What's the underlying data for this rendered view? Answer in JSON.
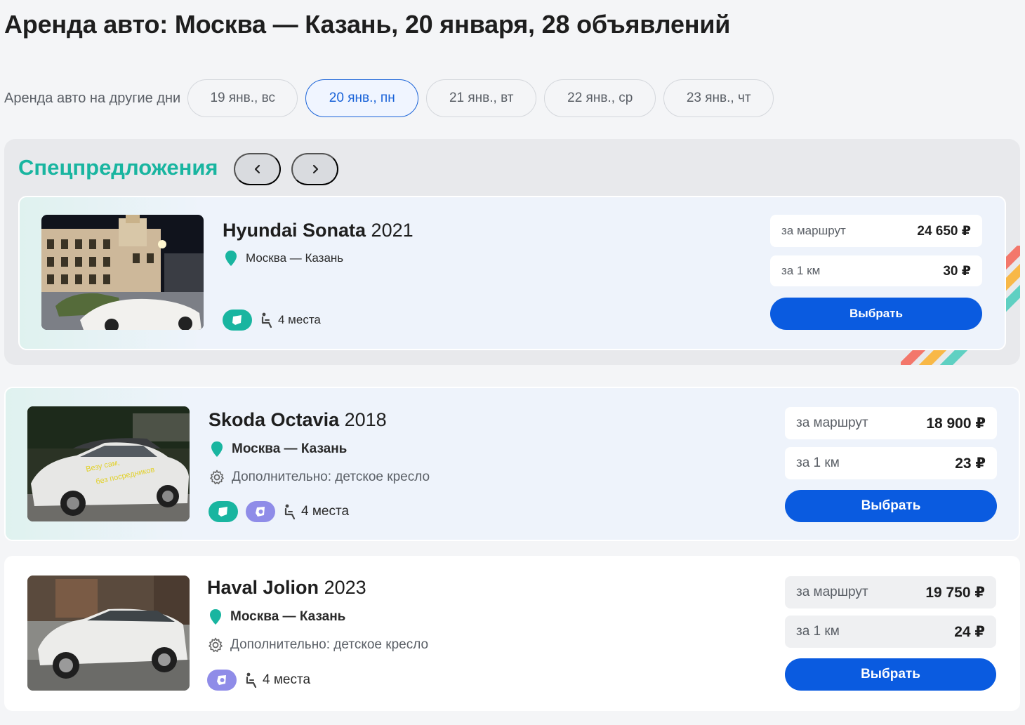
{
  "page": {
    "title": "Аренда авто: Москва — Казань, 20 января, 28 объявлений"
  },
  "days": {
    "label": "Аренда авто на другие дни",
    "items": [
      {
        "label": "19 янв., вс",
        "active": false
      },
      {
        "label": "20 янв., пн",
        "active": true
      },
      {
        "label": "21 янв., вт",
        "active": false
      },
      {
        "label": "22 янв., ср",
        "active": false
      },
      {
        "label": "23 янв., чт",
        "active": false
      }
    ]
  },
  "special": {
    "title": "Спецпредложения",
    "prev_icon": "chevron-left-icon",
    "next_icon": "chevron-right-icon"
  },
  "colors": {
    "accent_green": "#19b5a0",
    "accent_blue": "#0a5be0",
    "accent_purple": "#8f8ce8",
    "active_day": "#1a63d8"
  },
  "listings": [
    {
      "model": "Hyundai Sonata",
      "year": "2021",
      "route": "Москва — Казань",
      "extra": "",
      "features": [
        "car-chip-icon"
      ],
      "seats": "4 места",
      "price_route_label": "за маршрут",
      "price_route": "24 650 ₽",
      "price_km_label": "за 1 км",
      "price_km": "30 ₽",
      "button": "Выбрать"
    },
    {
      "model": "Skoda Octavia",
      "year": "2018",
      "route": "Москва — Казань",
      "extra": "Дополнительно: детское кресло",
      "features": [
        "car-chip-icon",
        "child-seat-chip-icon"
      ],
      "seats": "4 места",
      "price_route_label": "за маршрут",
      "price_route": "18 900 ₽",
      "price_km_label": "за 1 км",
      "price_km": "23 ₽",
      "button": "Выбрать",
      "photo_caption_line1": "Везу сам,",
      "photo_caption_line2": "без посредников"
    },
    {
      "model": "Haval Jolion",
      "year": "2023",
      "route": "Москва — Казань",
      "extra": "Дополнительно: детское кресло",
      "features": [
        "child-seat-chip-icon"
      ],
      "seats": "4 места",
      "price_route_label": "за маршрут",
      "price_route": "19 750 ₽",
      "price_km_label": "за 1 км",
      "price_km": "24 ₽",
      "button": "Выбрать"
    }
  ]
}
